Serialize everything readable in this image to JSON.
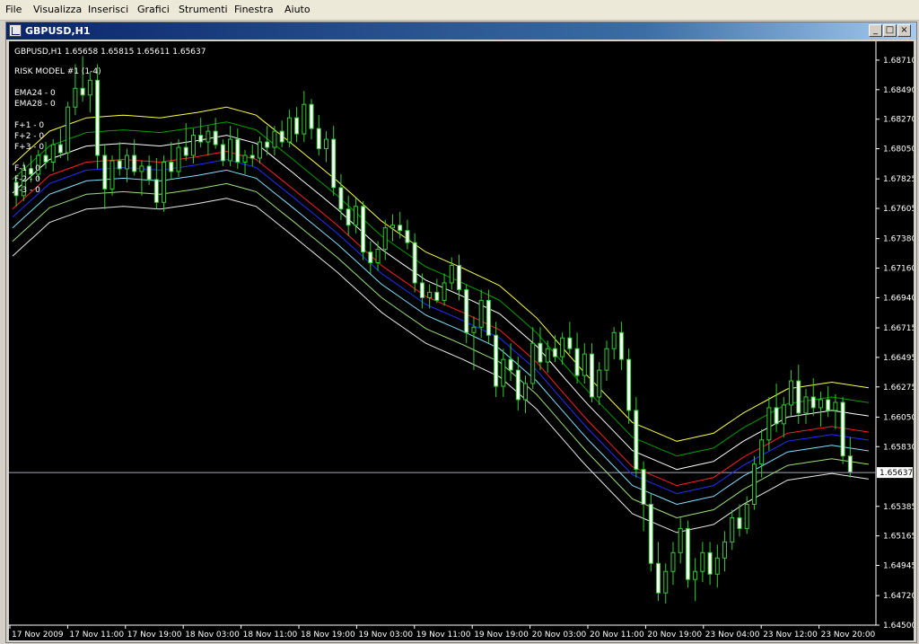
{
  "menu": [
    "File",
    "Visualizza",
    "Inserisci",
    "Grafici",
    "Strumenti",
    "Finestra",
    "Aiuto"
  ],
  "window": {
    "title": "GBPUSD,H1",
    "btn_min": "_",
    "btn_max": "□",
    "btn_close": "×"
  },
  "info": {
    "symbol_line": "GBPUSD,H1  1.65658 1.65815 1.65611 1.65637",
    "model": "RISK MODEL #1 (1-4)",
    "ema_lines": [
      "EMA24 - 0",
      "EMA28 - 0"
    ],
    "f_lines": [
      "F+1 - 0",
      "F+2 - 0",
      "F+3 - 0",
      "F-1 - 0",
      "F-2 - 0",
      "F-3 - 0"
    ]
  },
  "chart_data": {
    "type": "candlestick",
    "symbol": "GBPUSD",
    "timeframe": "H1",
    "ylim": [
      1.645,
      1.6885
    ],
    "y_ticks": [
      "1.68710",
      "1.68490",
      "1.68270",
      "1.68050",
      "1.67825",
      "1.67605",
      "1.67380",
      "1.67160",
      "1.66940",
      "1.66715",
      "1.66495",
      "1.66275",
      "1.66050",
      "1.65830",
      "1.65385",
      "1.65165",
      "1.64945",
      "1.64720",
      "1.64500"
    ],
    "x_ticks": [
      "17 Nov 2009",
      "17 Nov 11:00",
      "17 Nov 19:00",
      "18 Nov 03:00",
      "18 Nov 11:00",
      "18 Nov 19:00",
      "19 Nov 03:00",
      "19 Nov 11:00",
      "19 Nov 19:00",
      "20 Nov 03:00",
      "20 Nov 11:00",
      "20 Nov 19:00",
      "23 Nov 04:00",
      "23 Nov 12:00",
      "23 Nov 20:00"
    ],
    "current_price": "1.65637",
    "colors": {
      "background": "#000000",
      "candle_bull": "#000000",
      "candle_bear": "#ffffff",
      "wick": "#32cd32",
      "bid_line": "#a0a8b8",
      "ema24": "#ff2020",
      "ema28": "#2030ff",
      "f_plus_3": "#ffff40",
      "f_plus_2": "#00a000",
      "f_plus_1": "#ffffff",
      "f_minus_1": "#80e0ff",
      "f_minus_2": "#9be07a",
      "f_minus_3": "#e8e8e8"
    },
    "bands": [
      {
        "name": "F+3",
        "offset": 0.0033,
        "color_key": "f_plus_3"
      },
      {
        "name": "F+2",
        "offset": 0.0022,
        "color_key": "f_plus_2"
      },
      {
        "name": "F+1",
        "offset": 0.0012,
        "color_key": "f_plus_1"
      },
      {
        "name": "EMA24",
        "offset": 0.0,
        "color_key": "ema24"
      },
      {
        "name": "EMA28",
        "offset": -0.0006,
        "color_key": "ema28"
      },
      {
        "name": "F-1",
        "offset": -0.0014,
        "color_key": "f_minus_1"
      },
      {
        "name": "F-2",
        "offset": -0.0024,
        "color_key": "f_minus_2"
      },
      {
        "name": "F-3",
        "offset": -0.0035,
        "color_key": "f_minus_3"
      }
    ],
    "ema_center": [
      [
        0,
        1.676
      ],
      [
        10,
        1.6785
      ],
      [
        20,
        1.6795
      ],
      [
        30,
        1.6797
      ],
      [
        40,
        1.6795
      ],
      [
        50,
        1.6799
      ],
      [
        58,
        1.6803
      ],
      [
        66,
        1.6797
      ],
      [
        76,
        1.6775
      ],
      [
        88,
        1.6748
      ],
      [
        100,
        1.6718
      ],
      [
        112,
        1.6695
      ],
      [
        122,
        1.6683
      ],
      [
        132,
        1.667
      ],
      [
        142,
        1.6646
      ],
      [
        155,
        1.6605
      ],
      [
        168,
        1.6568
      ],
      [
        180,
        1.6554
      ],
      [
        190,
        1.656
      ],
      [
        198,
        1.6575
      ],
      [
        210,
        1.6593
      ],
      [
        222,
        1.6598
      ],
      [
        234,
        1.6593
      ]
    ],
    "candles": [
      [
        0,
        1.678,
        1.6784,
        1.6762,
        1.677
      ],
      [
        1,
        1.677,
        1.6795,
        1.6766,
        1.679
      ],
      [
        2,
        1.679,
        1.68,
        1.678,
        1.6786
      ],
      [
        3,
        1.6786,
        1.6804,
        1.6782,
        1.68
      ],
      [
        4,
        1.68,
        1.681,
        1.679,
        1.6795
      ],
      [
        5,
        1.6795,
        1.6812,
        1.6788,
        1.6808
      ],
      [
        6,
        1.6808,
        1.682,
        1.6798,
        1.6802
      ],
      [
        7,
        1.6802,
        1.684,
        1.6796,
        1.6836
      ],
      [
        8,
        1.6836,
        1.6868,
        1.683,
        1.685
      ],
      [
        9,
        1.685,
        1.6874,
        1.684,
        1.6845
      ],
      [
        10,
        1.6845,
        1.6862,
        1.6832,
        1.6856
      ],
      [
        11,
        1.6856,
        1.6868,
        1.679,
        1.68
      ],
      [
        12,
        1.68,
        1.6808,
        1.676,
        1.6775
      ],
      [
        13,
        1.6775,
        1.68,
        1.677,
        1.6796
      ],
      [
        14,
        1.6796,
        1.681,
        1.6785,
        1.679
      ],
      [
        15,
        1.679,
        1.6805,
        1.678,
        1.68
      ],
      [
        16,
        1.68,
        1.6812,
        1.6785,
        1.6788
      ],
      [
        17,
        1.6788,
        1.6796,
        1.677,
        1.6792
      ],
      [
        18,
        1.6792,
        1.68,
        1.6778,
        1.6782
      ],
      [
        19,
        1.6782,
        1.6798,
        1.676,
        1.6765
      ],
      [
        20,
        1.6765,
        1.68,
        1.6758,
        1.6795
      ],
      [
        21,
        1.6795,
        1.681,
        1.6782,
        1.6788
      ],
      [
        22,
        1.6788,
        1.6812,
        1.6784,
        1.6806
      ],
      [
        23,
        1.6806,
        1.6824,
        1.6796,
        1.68
      ],
      [
        24,
        1.68,
        1.682,
        1.6794,
        1.6815
      ],
      [
        25,
        1.6815,
        1.6828,
        1.6806,
        1.681
      ],
      [
        26,
        1.681,
        1.6822,
        1.68,
        1.6818
      ],
      [
        27,
        1.6818,
        1.6828,
        1.6805,
        1.6808
      ],
      [
        28,
        1.6808,
        1.6812,
        1.6792,
        1.6796
      ],
      [
        29,
        1.6796,
        1.6822,
        1.6792,
        1.6812
      ],
      [
        30,
        1.6812,
        1.682,
        1.679,
        1.6795
      ],
      [
        31,
        1.6795,
        1.6804,
        1.6786,
        1.68
      ],
      [
        32,
        1.68,
        1.6808,
        1.6792,
        1.6798
      ],
      [
        33,
        1.6798,
        1.6814,
        1.6794,
        1.681
      ],
      [
        34,
        1.681,
        1.6822,
        1.68,
        1.6806
      ],
      [
        35,
        1.6806,
        1.6822,
        1.68,
        1.6818
      ],
      [
        36,
        1.6818,
        1.6826,
        1.6806,
        1.681
      ],
      [
        37,
        1.681,
        1.6834,
        1.6806,
        1.6828
      ],
      [
        38,
        1.6828,
        1.6836,
        1.681,
        1.6816
      ],
      [
        39,
        1.6816,
        1.6848,
        1.681,
        1.6838
      ],
      [
        40,
        1.6838,
        1.6842,
        1.6812,
        1.682
      ],
      [
        41,
        1.682,
        1.683,
        1.68,
        1.6805
      ],
      [
        42,
        1.6805,
        1.6818,
        1.6795,
        1.6812
      ],
      [
        43,
        1.6812,
        1.6822,
        1.677,
        1.6776
      ],
      [
        44,
        1.6776,
        1.6786,
        1.6752,
        1.676
      ],
      [
        45,
        1.676,
        1.677,
        1.674,
        1.6748
      ],
      [
        46,
        1.6748,
        1.6768,
        1.6742,
        1.6762
      ],
      [
        47,
        1.6762,
        1.6766,
        1.6722,
        1.6728
      ],
      [
        48,
        1.6728,
        1.6736,
        1.6712,
        1.672
      ],
      [
        49,
        1.672,
        1.6736,
        1.6714,
        1.673
      ],
      [
        50,
        1.673,
        1.6752,
        1.6722,
        1.6746
      ],
      [
        51,
        1.6746,
        1.6756,
        1.6736,
        1.6748
      ],
      [
        52,
        1.6748,
        1.6758,
        1.6738,
        1.6744
      ],
      [
        53,
        1.6744,
        1.6752,
        1.673,
        1.6735
      ],
      [
        54,
        1.6735,
        1.6742,
        1.6698,
        1.6705
      ],
      [
        55,
        1.6705,
        1.6712,
        1.6686,
        1.6694
      ],
      [
        56,
        1.6694,
        1.6704,
        1.6686,
        1.6698
      ],
      [
        57,
        1.6698,
        1.6708,
        1.669,
        1.6692
      ],
      [
        58,
        1.6692,
        1.6712,
        1.6688,
        1.6705
      ],
      [
        59,
        1.6705,
        1.6724,
        1.67,
        1.6718
      ],
      [
        60,
        1.6718,
        1.6726,
        1.6692,
        1.67
      ],
      [
        61,
        1.67,
        1.6704,
        1.666,
        1.6668
      ],
      [
        62,
        1.6668,
        1.668,
        1.664,
        1.6672
      ],
      [
        63,
        1.6672,
        1.67,
        1.6664,
        1.6692
      ],
      [
        64,
        1.6692,
        1.67,
        1.666,
        1.6666
      ],
      [
        65,
        1.6666,
        1.6676,
        1.662,
        1.6628
      ],
      [
        66,
        1.6628,
        1.6656,
        1.662,
        1.6648
      ],
      [
        67,
        1.6648,
        1.666,
        1.6632,
        1.664
      ],
      [
        68,
        1.664,
        1.665,
        1.661,
        1.6618
      ],
      [
        69,
        1.6618,
        1.6636,
        1.6608,
        1.663
      ],
      [
        70,
        1.663,
        1.6672,
        1.6626,
        1.666
      ],
      [
        71,
        1.666,
        1.6672,
        1.664,
        1.6646
      ],
      [
        72,
        1.6646,
        1.6662,
        1.6638,
        1.6656
      ],
      [
        73,
        1.6656,
        1.6666,
        1.6646,
        1.665
      ],
      [
        74,
        1.665,
        1.6668,
        1.6644,
        1.6664
      ],
      [
        75,
        1.6664,
        1.6676,
        1.6652,
        1.6656
      ],
      [
        76,
        1.6656,
        1.6668,
        1.663,
        1.6636
      ],
      [
        77,
        1.6636,
        1.666,
        1.663,
        1.6652
      ],
      [
        78,
        1.6652,
        1.666,
        1.6616,
        1.662
      ],
      [
        79,
        1.662,
        1.6646,
        1.6614,
        1.664
      ],
      [
        80,
        1.664,
        1.6662,
        1.6632,
        1.6656
      ],
      [
        81,
        1.6656,
        1.6672,
        1.6648,
        1.6668
      ],
      [
        82,
        1.6668,
        1.6676,
        1.664,
        1.6648
      ],
      [
        83,
        1.6648,
        1.6656,
        1.66,
        1.661
      ],
      [
        84,
        1.661,
        1.662,
        1.656,
        1.6566
      ],
      [
        85,
        1.6566,
        1.6572,
        1.652,
        1.654
      ],
      [
        86,
        1.654,
        1.6548,
        1.649,
        1.6496
      ],
      [
        87,
        1.6496,
        1.6512,
        1.6468,
        1.6474
      ],
      [
        88,
        1.6474,
        1.6496,
        1.6466,
        1.649
      ],
      [
        89,
        1.649,
        1.6512,
        1.648,
        1.6504
      ],
      [
        90,
        1.6504,
        1.653,
        1.6496,
        1.6522
      ],
      [
        91,
        1.6522,
        1.6528,
        1.6478,
        1.6484
      ],
      [
        92,
        1.6484,
        1.65,
        1.6468,
        1.649
      ],
      [
        93,
        1.649,
        1.6512,
        1.6482,
        1.6504
      ],
      [
        94,
        1.6504,
        1.6512,
        1.648,
        1.6488
      ],
      [
        95,
        1.6488,
        1.651,
        1.6478,
        1.65
      ],
      [
        96,
        1.65,
        1.652,
        1.649,
        1.6512
      ],
      [
        97,
        1.6512,
        1.6536,
        1.6506,
        1.653
      ],
      [
        98,
        1.653,
        1.654,
        1.6516,
        1.6522
      ],
      [
        99,
        1.6522,
        1.6546,
        1.6518,
        1.654
      ],
      [
        100,
        1.654,
        1.6576,
        1.6536,
        1.657
      ],
      [
        101,
        1.657,
        1.6596,
        1.656,
        1.6588
      ],
      [
        102,
        1.6588,
        1.662,
        1.658,
        1.6612
      ],
      [
        103,
        1.6612,
        1.663,
        1.6594,
        1.66
      ],
      [
        104,
        1.66,
        1.662,
        1.659,
        1.6614
      ],
      [
        105,
        1.6614,
        1.664,
        1.6606,
        1.6632
      ],
      [
        106,
        1.6632,
        1.6644,
        1.66,
        1.6608
      ],
      [
        107,
        1.6608,
        1.6626,
        1.66,
        1.662
      ],
      [
        108,
        1.662,
        1.6634,
        1.6606,
        1.6612
      ],
      [
        109,
        1.6612,
        1.6624,
        1.6598,
        1.6618
      ],
      [
        110,
        1.6618,
        1.6628,
        1.6605,
        1.661
      ],
      [
        111,
        1.661,
        1.6622,
        1.6596,
        1.6616
      ],
      [
        112,
        1.6616,
        1.662,
        1.657,
        1.6576
      ],
      [
        113,
        1.6576,
        1.659,
        1.656,
        1.6564
      ]
    ]
  }
}
